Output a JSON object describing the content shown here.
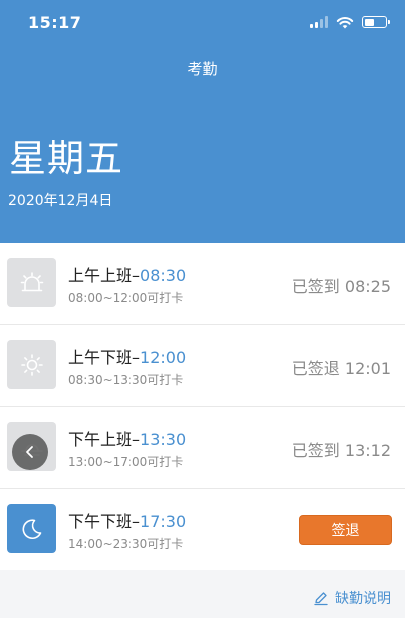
{
  "status_bar": {
    "time": "15:17"
  },
  "header": {
    "title": "考勤",
    "weekday": "星期五",
    "date": "2020年12月4日",
    "bg_color": "#4a90d0"
  },
  "rows": [
    {
      "title": "上午上班",
      "dash": "–",
      "time": "08:30",
      "range": "08:00~12:00可打卡",
      "status": "已签到 08:25",
      "icon": "alarm-clock-icon"
    },
    {
      "title": "上午下班",
      "dash": "–",
      "time": "12:00",
      "range": "08:30~13:30可打卡",
      "status": "已签退 12:01",
      "icon": "sun-icon"
    },
    {
      "title": "下午上班",
      "dash": "–",
      "time": "13:30",
      "range": "13:00~17:00可打卡",
      "status": "已签到 13:12",
      "icon": "sunset-icon"
    },
    {
      "title": "下午下班",
      "dash": "–",
      "time": "17:30",
      "range": "14:00~23:30可打卡",
      "button": "签退",
      "icon": "moon-icon"
    }
  ],
  "footer": {
    "link_label": "缺勤说明",
    "icon": "edit-icon"
  },
  "colors": {
    "accent": "#4a90d0",
    "button": "#e8772c",
    "muted": "#8a8a8a"
  }
}
